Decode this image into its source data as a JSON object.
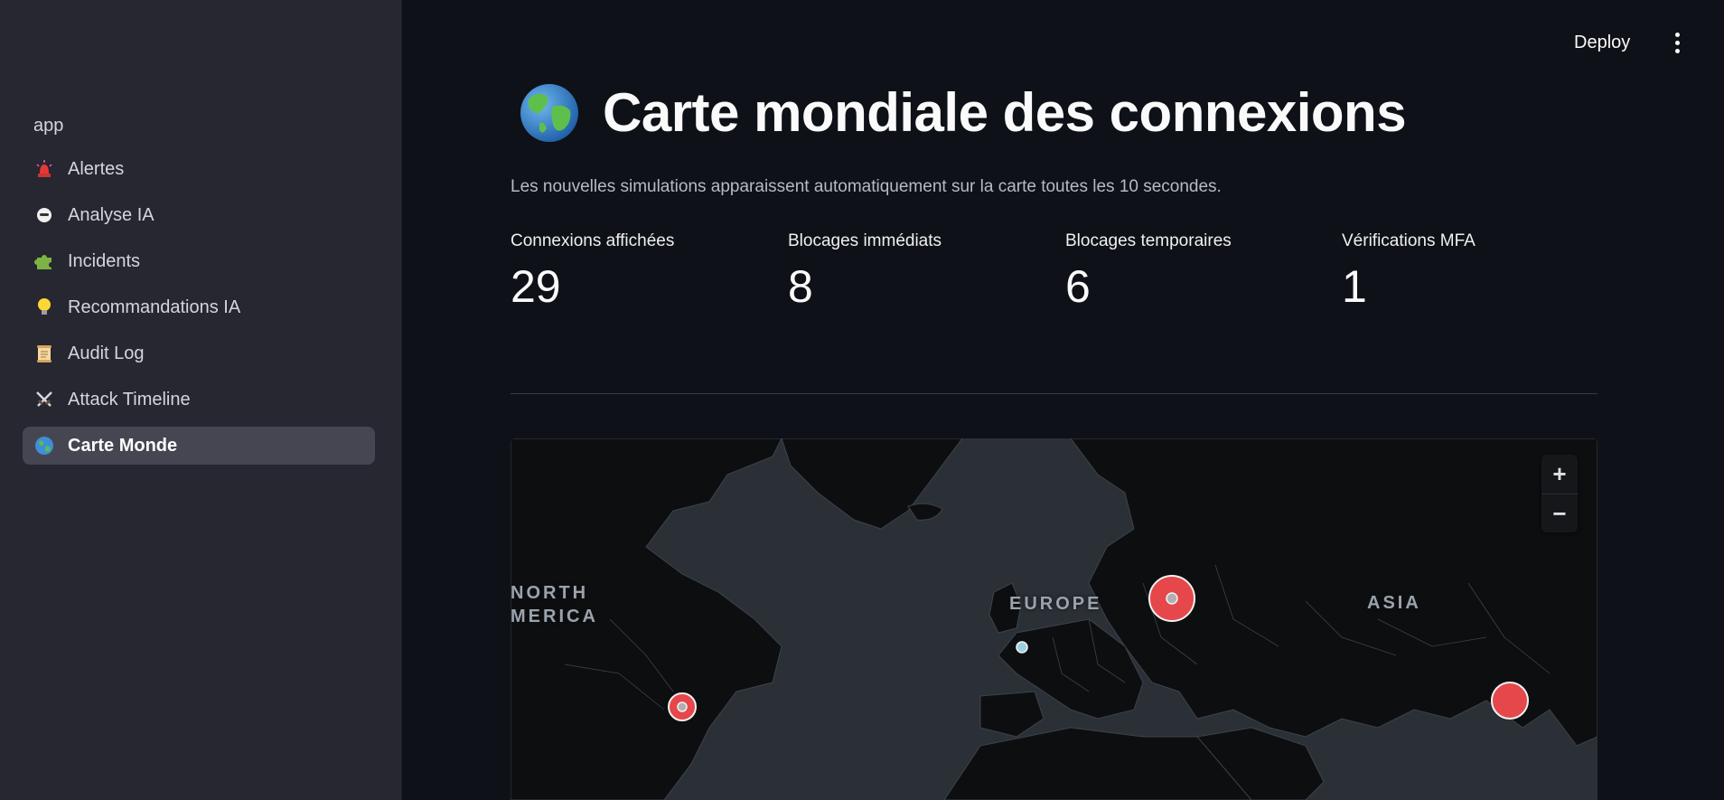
{
  "sidebar": {
    "app_label": "app",
    "items": [
      {
        "label": "Alertes",
        "icon": "rotating-light-icon"
      },
      {
        "label": "Analyse IA",
        "icon": "face-icon"
      },
      {
        "label": "Incidents",
        "icon": "puzzle-piece-icon"
      },
      {
        "label": "Recommandations IA",
        "icon": "light-bulb-icon"
      },
      {
        "label": "Audit Log",
        "icon": "scroll-icon"
      },
      {
        "label": "Attack Timeline",
        "icon": "crossed-swords-icon"
      },
      {
        "label": "Carte Monde",
        "icon": "globe-icon",
        "active": true
      }
    ]
  },
  "header": {
    "deploy_label": "Deploy"
  },
  "main": {
    "title": "Carte mondiale des connexions",
    "caption": "Les nouvelles simulations apparaissent automatiquement sur la carte toutes les 10 secondes.",
    "metrics": [
      {
        "label": "Connexions affichées",
        "value": "29"
      },
      {
        "label": "Blocages immédiats",
        "value": "8"
      },
      {
        "label": "Blocages temporaires",
        "value": "6"
      },
      {
        "label": "Vérifications MFA",
        "value": "1"
      }
    ]
  },
  "map": {
    "labels": {
      "north_america_line1": "NORTH",
      "north_america_line2": "MERICA",
      "europe": "EUROPE",
      "asia": "ASIA"
    },
    "zoom_in": "+",
    "zoom_out": "−",
    "colors": {
      "ocean": "#2b3036",
      "land": "#0d0e10",
      "block_marker": "#e5474b",
      "mfa_marker": "#9ecfe0"
    }
  }
}
